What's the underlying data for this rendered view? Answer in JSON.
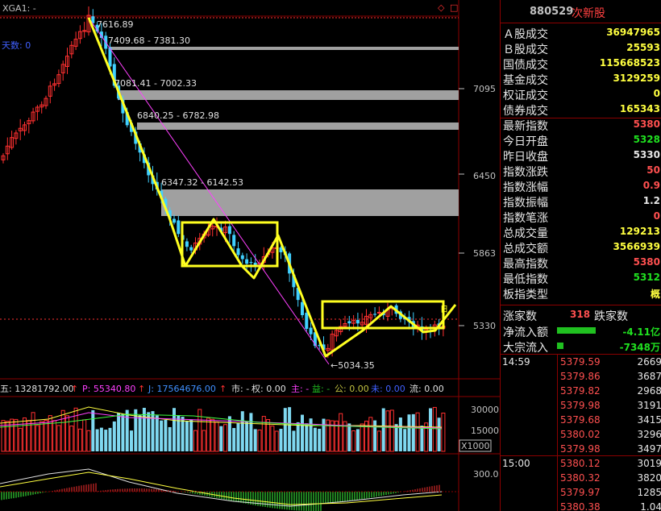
{
  "chart": {
    "header_label": "XGA1: -",
    "left_label": "天数: 0",
    "annotations": [
      "7616.89",
      "7409.68 - 7381.30",
      "7081.41 - 7002.33",
      "6840.25 - 6782.98",
      "6347.32 - 6142.53",
      "5034.35"
    ],
    "box_marker": "日",
    "price_axis": [
      "7095",
      "6450",
      "5863",
      "5330"
    ],
    "volume_axis": [
      "30000",
      "15000",
      "X1000"
    ],
    "macd_axis": [
      "300.0"
    ],
    "info_bar": {
      "a": "五: 13281792.00",
      "b": "P: 55340.80",
      "c": "J: 17564676.00",
      "d": "市: -",
      "e": "权: 0.00",
      "f": "主: -",
      "g": "益: -",
      "h": "公: 0.00",
      "i": "未: 0.00",
      "j": "流: 0.00"
    },
    "colors": {
      "up": "#ff3030",
      "down": "#40d0ff",
      "highlight": "#ffff20",
      "accent": "#ff3030"
    }
  },
  "sidebar": {
    "code": "880529",
    "name": "次新股",
    "stats": [
      {
        "label": "Ａ股成交",
        "value": "36947965",
        "cls": "y"
      },
      {
        "label": "Ｂ股成交",
        "value": "25593",
        "cls": "y"
      },
      {
        "label": "国债成交",
        "value": "115668523",
        "cls": "y"
      },
      {
        "label": "基金成交",
        "value": "3129259",
        "cls": "y"
      },
      {
        "label": "权证成交",
        "value": "0",
        "cls": "y"
      },
      {
        "label": "债券成交",
        "value": "165343",
        "cls": "y"
      },
      {
        "label": "最新指数",
        "value": "5380",
        "cls": "r"
      },
      {
        "label": "今日开盘",
        "value": "5328",
        "cls": "g"
      },
      {
        "label": "昨日收盘",
        "value": "5330",
        "cls": "w"
      },
      {
        "label": "指数涨跌",
        "value": "50",
        "cls": "r"
      },
      {
        "label": "指数涨幅",
        "value": "0.9",
        "cls": "r"
      },
      {
        "label": "指数振幅",
        "value": "1.2",
        "cls": "w"
      },
      {
        "label": "指数笔涨",
        "value": "0",
        "cls": "r"
      },
      {
        "label": "总成交量",
        "value": "129213",
        "cls": "y"
      },
      {
        "label": "总成交额",
        "value": "3566939",
        "cls": "y"
      },
      {
        "label": "最高指数",
        "value": "5380",
        "cls": "r"
      },
      {
        "label": "最低指数",
        "value": "5312",
        "cls": "g"
      },
      {
        "label": "板指类型",
        "value": "概",
        "cls": "y"
      }
    ],
    "updown": {
      "up_label": "涨家数",
      "up_value": "318",
      "down_label": "跌家数"
    },
    "flow1": {
      "label": "净流入额",
      "value": "-4.11亿"
    },
    "flow2": {
      "label": "大宗流入",
      "value": "-7348万"
    },
    "ticks1": {
      "time": "14:59",
      "rows": [
        {
          "p": "5379.59",
          "v": "2669"
        },
        {
          "p": "5379.86",
          "v": "3687"
        },
        {
          "p": "5379.82",
          "v": "2968"
        },
        {
          "p": "5379.98",
          "v": "3191"
        },
        {
          "p": "5379.68",
          "v": "3415"
        },
        {
          "p": "5380.02",
          "v": "3296"
        },
        {
          "p": "5379.98",
          "v": "3497"
        }
      ]
    },
    "ticks2": {
      "time": "15:00",
      "rows": [
        {
          "p": "5380.12",
          "v": "3019"
        },
        {
          "p": "5380.32",
          "v": "3820"
        },
        {
          "p": "5379.97",
          "v": "1285"
        },
        {
          "p": "5380.38",
          "v": "1.04"
        }
      ]
    }
  }
}
